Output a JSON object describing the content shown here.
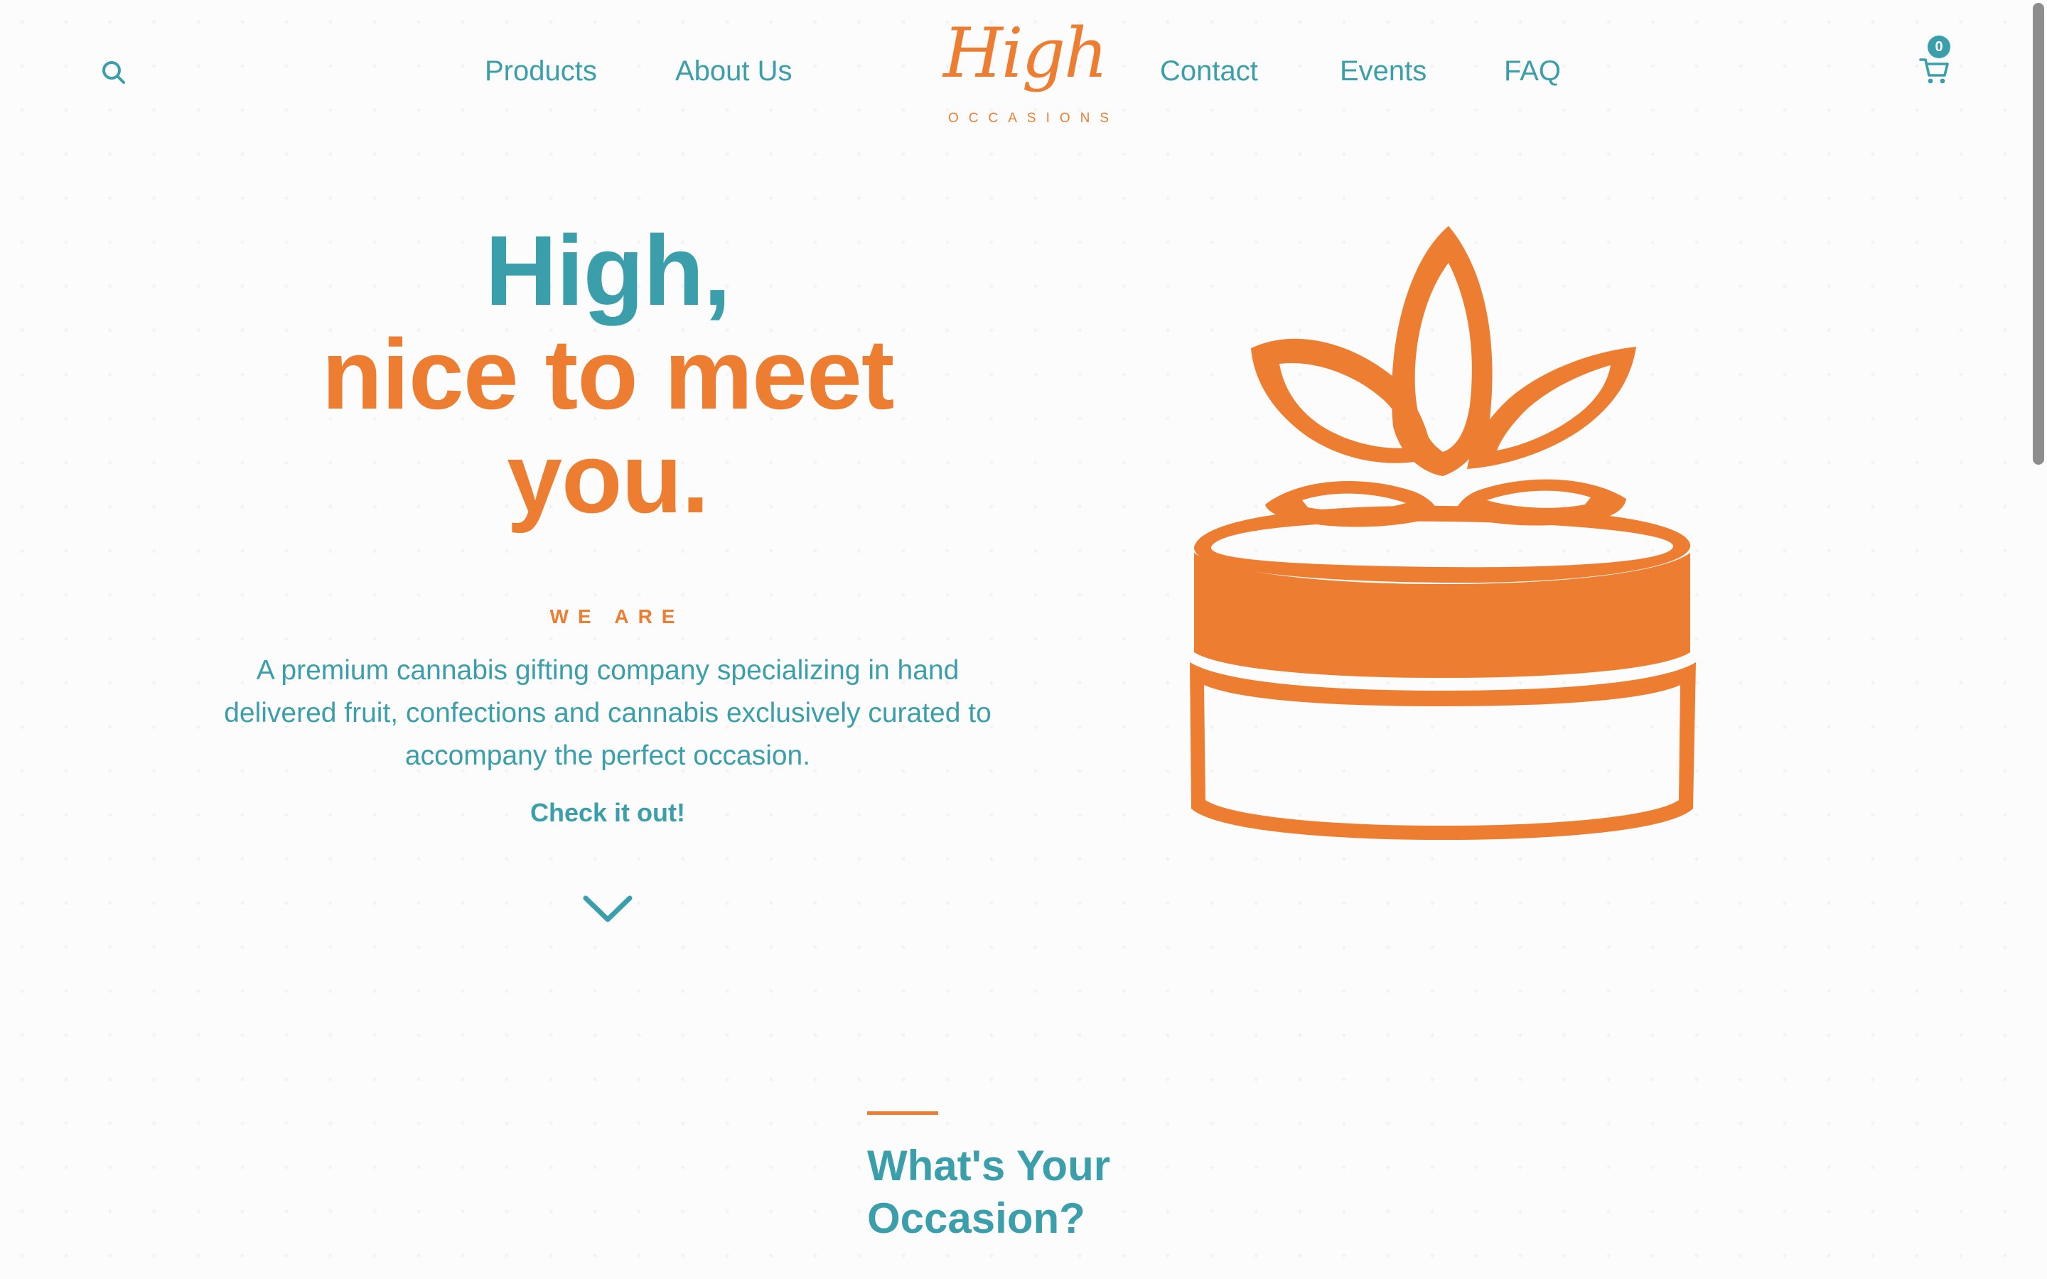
{
  "header": {
    "nav_left": [
      {
        "label": "Products"
      },
      {
        "label": "About Us"
      }
    ],
    "nav_right": [
      {
        "label": "Contact"
      },
      {
        "label": "Events"
      },
      {
        "label": "FAQ"
      }
    ],
    "logo": {
      "script": "High",
      "subtitle": "OCCASIONS"
    },
    "search_icon": "search-icon",
    "cart": {
      "icon": "cart-icon",
      "count": "0"
    }
  },
  "hero": {
    "heading_line1": "High,",
    "heading_line2": "nice to meet you.",
    "eyebrow": "WE ARE",
    "description": "A premium cannabis gifting company specializing in hand delivered fruit, confections and cannabis exclusively curated to accompany the perfect occasion.",
    "cta": "Check it out!",
    "scroll_icon": "chevron-down-icon",
    "illustration": "gift-box-with-leaf-bow"
  },
  "section": {
    "title": "What's Your Occasion?"
  },
  "colors": {
    "teal": "#3a9faa",
    "orange": "#ed7d31",
    "background": "#fcfcfc"
  }
}
